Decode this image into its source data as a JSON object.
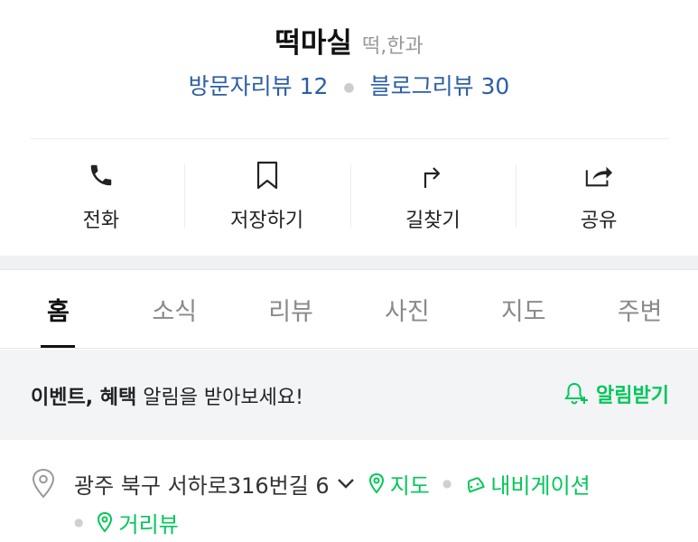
{
  "place": {
    "name": "떡마실",
    "category": "떡,한과",
    "visitor_reviews": "방문자리뷰 12",
    "blog_reviews": "블로그리뷰 30"
  },
  "actions": [
    {
      "label": "전화",
      "icon": "phone-icon"
    },
    {
      "label": "저장하기",
      "icon": "bookmark-icon"
    },
    {
      "label": "길찾기",
      "icon": "directions-arrow-icon"
    },
    {
      "label": "공유",
      "icon": "share-icon"
    }
  ],
  "tabs": [
    {
      "label": "홈",
      "active": true
    },
    {
      "label": "소식"
    },
    {
      "label": "리뷰"
    },
    {
      "label": "사진"
    },
    {
      "label": "지도"
    },
    {
      "label": "주변"
    }
  ],
  "event_bar": {
    "bold_text": "이벤트, 혜택",
    "text": " 알림을 받아보세요!",
    "cta": "알림받기"
  },
  "address": {
    "text": "광주 북구 서하로316번길 6",
    "map_link": "지도",
    "navi_link": "내비게이션",
    "street_link": "거리뷰"
  },
  "colors": {
    "link_blue": "#2c5ea5",
    "naver_green": "#03c75a",
    "band_gray": "#f2f4f6"
  }
}
